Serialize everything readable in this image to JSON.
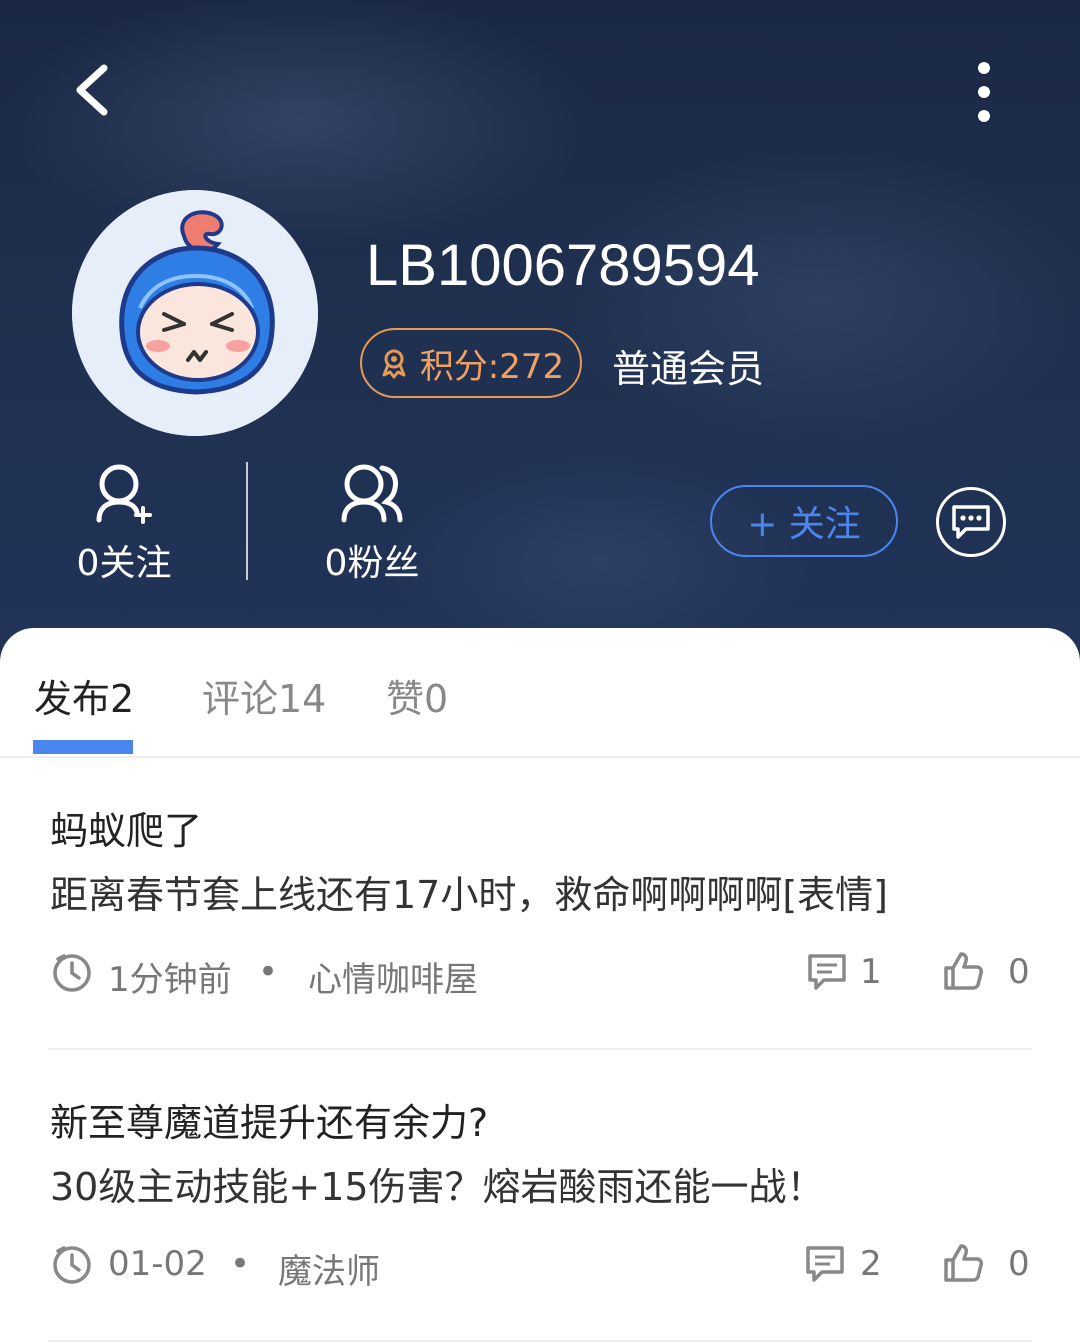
{
  "header": {
    "username": "LB1006789594",
    "points_label": "积分:272",
    "member_level": "普通会员",
    "following_label": "0关注",
    "fans_label": "0粉丝",
    "follow_button_label": "+ 关注"
  },
  "icons": {
    "back": "back-chevron-icon",
    "more": "more-vertical-icon",
    "follow": "user-plus-icon",
    "fans": "users-icon",
    "message": "chat-bubble-icon",
    "points": "medal-icon",
    "time": "clock-icon",
    "comment": "comment-icon",
    "like": "thumbs-up-icon"
  },
  "colors": {
    "accent": "#4a86ee",
    "points_badge": "#e79a55",
    "header_bg": "#1f2f4e"
  },
  "tabs": [
    {
      "label": "发布2",
      "active": true
    },
    {
      "label": "评论14",
      "active": false
    },
    {
      "label": "赞0",
      "active": false
    }
  ],
  "posts": [
    {
      "title": "蚂蚁爬了",
      "body": "距离春节套上线还有17小时，救命啊啊啊啊[表情]",
      "time": "1分钟前",
      "separator": "•",
      "forum": "心情咖啡屋",
      "comments": "1",
      "likes": "0"
    },
    {
      "title": "新至尊魔道提升还有余力?",
      "body": "30级主动技能+15伤害？熔岩酸雨还能一战！",
      "time": "01-02",
      "separator": "•",
      "forum": "魔法师",
      "comments": "2",
      "likes": "0"
    }
  ]
}
